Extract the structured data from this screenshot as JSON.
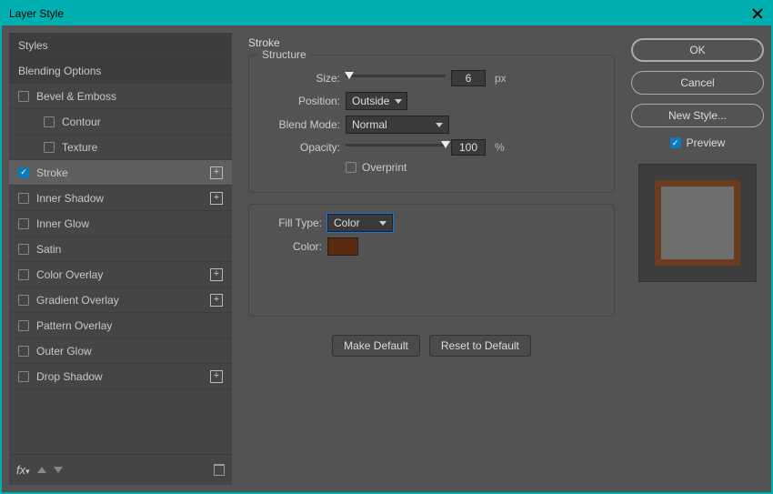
{
  "window": {
    "title": "Layer Style"
  },
  "sidebar": {
    "styles_label": "Styles",
    "blending_label": "Blending Options",
    "items": [
      {
        "label": "Bevel & Emboss",
        "checked": false,
        "plus": false
      },
      {
        "label": "Contour",
        "checked": false,
        "plus": false,
        "indent": true
      },
      {
        "label": "Texture",
        "checked": false,
        "plus": false,
        "indent": true
      },
      {
        "label": "Stroke",
        "checked": true,
        "plus": true,
        "active": true
      },
      {
        "label": "Inner Shadow",
        "checked": false,
        "plus": true
      },
      {
        "label": "Inner Glow",
        "checked": false,
        "plus": false
      },
      {
        "label": "Satin",
        "checked": false,
        "plus": false
      },
      {
        "label": "Color Overlay",
        "checked": false,
        "plus": true
      },
      {
        "label": "Gradient Overlay",
        "checked": false,
        "plus": true
      },
      {
        "label": "Pattern Overlay",
        "checked": false,
        "plus": false
      },
      {
        "label": "Outer Glow",
        "checked": false,
        "plus": false
      },
      {
        "label": "Drop Shadow",
        "checked": false,
        "plus": true
      }
    ]
  },
  "stroke": {
    "title": "Stroke",
    "structure_label": "Structure",
    "size_label": "Size:",
    "size_value": "6",
    "size_unit": "px",
    "size_pct": 4,
    "position_label": "Position:",
    "position_value": "Outside",
    "blendmode_label": "Blend Mode:",
    "blendmode_value": "Normal",
    "opacity_label": "Opacity:",
    "opacity_value": "100",
    "opacity_unit": "%",
    "opacity_pct": 100,
    "overprint_label": "Overprint",
    "overprint_checked": false,
    "filltype_label": "Fill Type:",
    "filltype_value": "Color",
    "color_label": "Color:",
    "color_value": "#5b2a10",
    "make_default": "Make Default",
    "reset_default": "Reset to Default"
  },
  "right": {
    "ok": "OK",
    "cancel": "Cancel",
    "new_style": "New Style...",
    "preview_label": "Preview",
    "preview_checked": true
  }
}
